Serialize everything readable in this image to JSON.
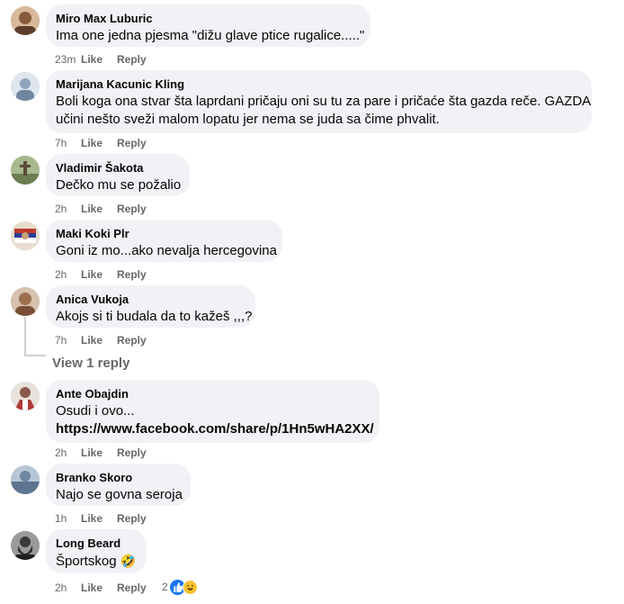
{
  "comments": [
    {
      "author": "Miro Max Luburic",
      "lines": [
        "Ima one jedna pjesma \"dižu glave ptice rugalice.....\""
      ],
      "time": "23m",
      "like": "Like",
      "reply": "Reply",
      "avatar_color": "#c9a58b"
    },
    {
      "author": "Marijana Kacunic Kling",
      "lines": [
        "Boli koga ona stvar šta laprdani pričaju oni su tu za pare i pričaće šta gazda reče. GAZDA",
        "učini nešto sveži malom lopatu jer nema se juda sa čime phvalit."
      ],
      "time": "7h",
      "like": "Like",
      "reply": "Reply",
      "avatar_color": "#9fb3c8"
    },
    {
      "author": "Vladimir Šakota",
      "lines": [
        "Dečko mu se požalio"
      ],
      "time": "2h",
      "like": "Like",
      "reply": "Reply",
      "avatar_color": "#8a9a6e"
    },
    {
      "author": "Maki Koki Plr",
      "lines": [
        "Goni iz mo...ako nevalja hercegovina"
      ],
      "time": "2h",
      "like": "Like",
      "reply": "Reply",
      "avatar_color": "#c8a27a"
    },
    {
      "author": "Anica Vukoja",
      "lines": [
        "Akojs si ti budala da to kažeš ,,,?"
      ],
      "time": "7h",
      "like": "Like",
      "reply": "Reply",
      "avatar_color": "#b98c6b"
    },
    {
      "author": "Ante Obajdin",
      "lines": [
        "Osudi i ovo..."
      ],
      "link": "https://www.facebook.com/share/p/1Hn5wHA2XX/",
      "time": "2h",
      "like": "Like",
      "reply": "Reply",
      "avatar_color": "#b03a3a"
    },
    {
      "author": "Branko Skoro",
      "lines": [
        "Najo se govna seroja"
      ],
      "time": "1h",
      "like": "Like",
      "reply": "Reply",
      "avatar_color": "#7f95ad"
    },
    {
      "author": "Long Beard",
      "lines": [
        "Športskog"
      ],
      "time": "2h",
      "like": "Like",
      "reply": "Reply",
      "avatar_color": "#4a4a4a",
      "reaction_count": "2"
    }
  ],
  "view_reply": "View 1 reply",
  "reaction_emoji": "🤣",
  "reaction_icons": [
    "like-reaction-icon",
    "haha-reaction-icon"
  ],
  "colors": {
    "bubble": "#f0f2f5",
    "meta": "#65676b",
    "like_blue": "#1877f2"
  }
}
